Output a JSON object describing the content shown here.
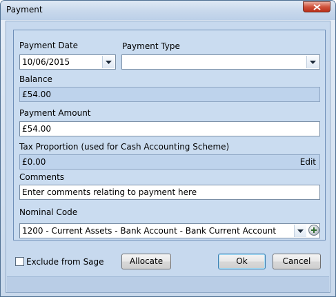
{
  "window": {
    "title": "Payment"
  },
  "form": {
    "payment_date_label": "Payment Date",
    "payment_date_value": "10/06/2015",
    "payment_type_label": "Payment Type",
    "payment_type_value": "",
    "balance_label": "Balance",
    "balance_value": "£54.00",
    "payment_amount_label": "Payment Amount",
    "payment_amount_value": "£54.00",
    "tax_label": "Tax Proportion (used for Cash Accounting Scheme)",
    "tax_value": "£0.00",
    "tax_edit": "Edit",
    "comments_label": "Comments",
    "comments_value": "Enter comments relating to payment here",
    "nominal_label": "Nominal Code",
    "nominal_value": "1200 - Current Assets - Bank Account - Bank Current Account"
  },
  "footer": {
    "exclude_label": "Exclude from Sage",
    "exclude_checked": false,
    "allocate_label": "Allocate",
    "ok_label": "Ok",
    "cancel_label": "Cancel"
  },
  "colors": {
    "title_bar": "#c8d8ec",
    "panel": "#cadcf0",
    "readonly_field": "#bed3ec",
    "close_button": "#d0533c"
  },
  "icons": [
    "close-icon",
    "dropdown-arrow-icon",
    "add-icon"
  ]
}
